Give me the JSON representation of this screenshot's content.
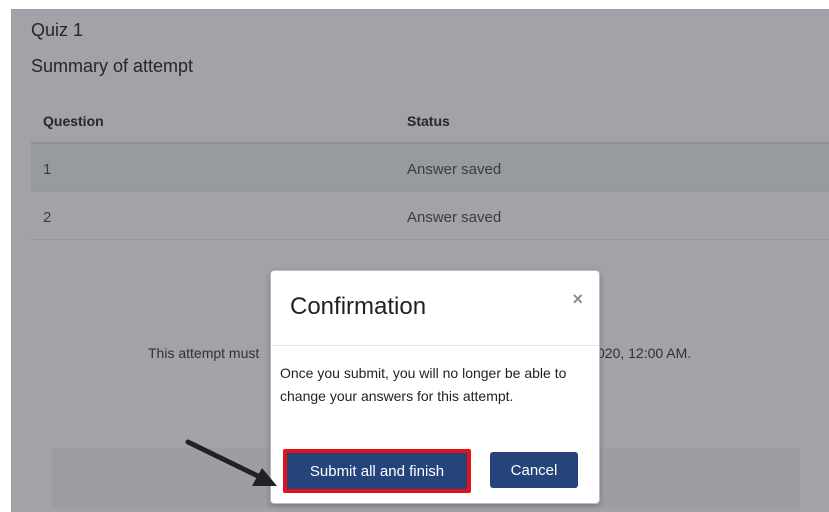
{
  "page": {
    "quiz_title": "Quiz 1",
    "summary_title": "Summary of attempt",
    "table": {
      "headers": [
        "Question",
        "Status"
      ],
      "rows": [
        {
          "question": "1",
          "status": "Answer saved"
        },
        {
          "question": "2",
          "status": "Answer saved"
        }
      ]
    },
    "time_note_left": "This attempt must",
    "time_note_right": "020, 12:00 AM."
  },
  "modal": {
    "title": "Confirmation",
    "close_glyph": "×",
    "body": "Once you submit, you will no longer be able to change your answers for this attempt.",
    "submit_label": "Submit all and finish",
    "cancel_label": "Cancel"
  },
  "colors": {
    "primary": "#24447b",
    "highlight": "#e4121c",
    "overlay": "#a1a3a8"
  },
  "icons": {
    "arrow": "annotation-arrow-icon",
    "close": "close-icon"
  }
}
